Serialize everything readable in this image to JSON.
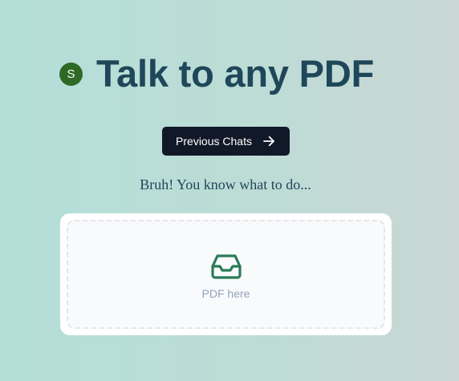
{
  "header": {
    "avatar_initial": "S",
    "title": "Talk to any PDF"
  },
  "actions": {
    "previous_chats_label": "Previous Chats",
    "arrow_icon": "arrow-right-icon"
  },
  "main": {
    "subtitle": "Bruh! You know what to do..."
  },
  "upload": {
    "icon": "inbox-icon",
    "label": "PDF here"
  },
  "colors": {
    "title": "#1e4759",
    "avatar": "#2f6a25",
    "button_bg": "#111827",
    "upload_icon": "#2b7a55",
    "placeholder_text": "#94a3b8"
  }
}
